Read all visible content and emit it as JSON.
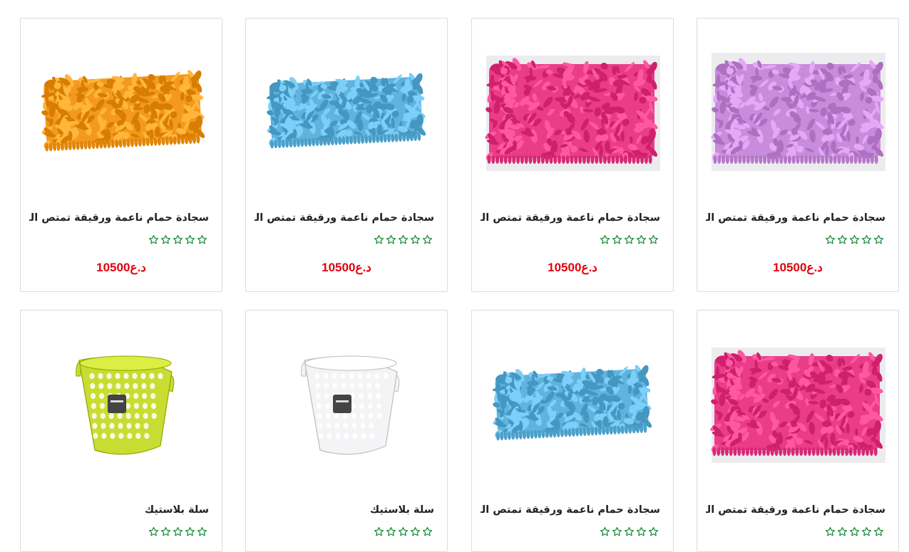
{
  "colors": {
    "price": "#e3000f",
    "star_outline": "#1e8a3a",
    "card_border": "#dcdcdc"
  },
  "products": [
    {
      "title": "سجادة حمام ناعمة ورقيقة تمتص الماء ...",
      "price": "10500د.ع",
      "rating": 0,
      "image": "orange-shaggy-bath-mat",
      "image_color": "#f39a1e"
    },
    {
      "title": "سجادة حمام ناعمة ورقيقة تمتص الماء ...",
      "price": "10500د.ع",
      "rating": 0,
      "image": "blue-shaggy-bath-mat",
      "image_color": "#5fb3dd"
    },
    {
      "title": "سجادة حمام ناعمة ورقيقة تمتص الماء ...",
      "price": "10500د.ع",
      "rating": 0,
      "image": "pink-shaggy-bath-mat",
      "image_color": "#ea3c87"
    },
    {
      "title": "سجادة حمام ناعمة ورقيقة تمتص الماء ...",
      "price": "10500د.ع",
      "rating": 0,
      "image": "lilac-shaggy-bath-mat",
      "image_color": "#c98bdc"
    },
    {
      "title": "سلة بلاستيك",
      "rating": 0,
      "image": "lime-plastic-basket",
      "image_color": "#c8dc32"
    },
    {
      "title": "سلة بلاستيك",
      "rating": 0,
      "image": "white-plastic-basket",
      "image_color": "#f4f4f6"
    },
    {
      "title": "سجادة حمام ناعمة ورقيقة تمتص الماء ...",
      "rating": 0,
      "image": "blue-shaggy-bath-mat",
      "image_color": "#5fb3dd"
    },
    {
      "title": "سجادة حمام ناعمة ورقيقة تمتص الماء ...",
      "rating": 0,
      "image": "pink-shaggy-bath-mat",
      "image_color": "#ea3c87"
    }
  ]
}
